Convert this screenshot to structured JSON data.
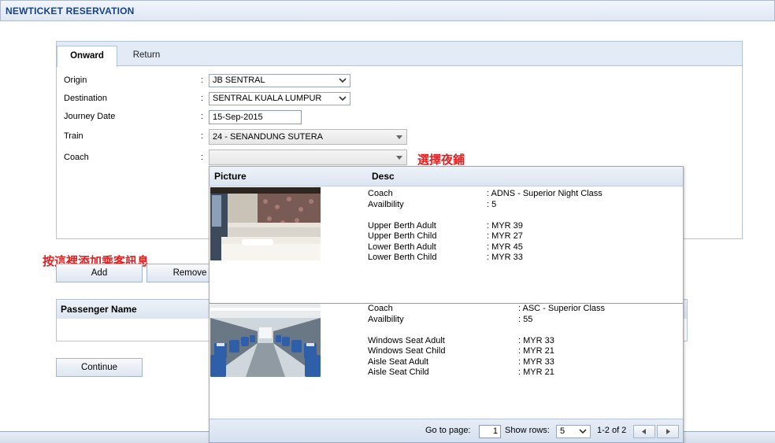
{
  "window": {
    "title": "NEWTICKET RESERVATION"
  },
  "tabs": {
    "onward": "Onward",
    "return": "Return"
  },
  "form": {
    "origin_label": "Origin",
    "destination_label": "Destination",
    "journey_date_label": "Journey Date",
    "train_label": "Train",
    "coach_label": "Coach",
    "colon": ":",
    "origin_value": "JB SENTRAL",
    "destination_value": "SENTRAL KUALA LUMPUR",
    "journey_date_value": "15-Sep-2015",
    "train_value": "24 - SENANDUNG SUTERA",
    "coach_value": ""
  },
  "annotations": {
    "select_sleeper": "選擇夜鋪",
    "add_passenger": "按這裡添加乘客訊息"
  },
  "buttons": {
    "add": "Add",
    "remove": "Remove",
    "continue": "Continue"
  },
  "passenger_grid": {
    "header": "Passenger Name"
  },
  "coach_dropdown": {
    "col_picture": "Picture",
    "col_desc": "Desc",
    "rows": [
      {
        "image": "sleeper-cabin-photo",
        "fields": [
          {
            "label": "Coach",
            "value": ": ADNS - Superior Night Class"
          },
          {
            "label": "Availbility",
            "value": ": 5"
          },
          {
            "label": "Upper Berth Adult",
            "value": ": MYR 39"
          },
          {
            "label": "Upper Berth Child",
            "value": ": MYR 27"
          },
          {
            "label": "Lower Berth Adult",
            "value": ": MYR 45"
          },
          {
            "label": "Lower Berth Child",
            "value": ": MYR 33"
          }
        ]
      },
      {
        "image": "seating-coach-photo",
        "fields": [
          {
            "label": "Coach",
            "value": ": ASC - Superior Class"
          },
          {
            "label": "Availbility",
            "value": ": 55"
          },
          {
            "label": "Windows Seat Adult",
            "value": ": MYR 33"
          },
          {
            "label": "Windows Seat Child",
            "value": ": MYR 21"
          },
          {
            "label": "Aisle Seat Adult",
            "value": ": MYR 33"
          },
          {
            "label": "Aisle Seat Child",
            "value": ": MYR 21"
          }
        ]
      }
    ],
    "pager": {
      "goto_label": "Go to page:",
      "page_value": "1",
      "show_rows_label": "Show rows:",
      "rows_value": "5",
      "range_text": "1-2 of 2"
    }
  },
  "colors": {
    "title": "#15428b",
    "annotation": "#e02020",
    "header_bg": "#dce5f1"
  }
}
